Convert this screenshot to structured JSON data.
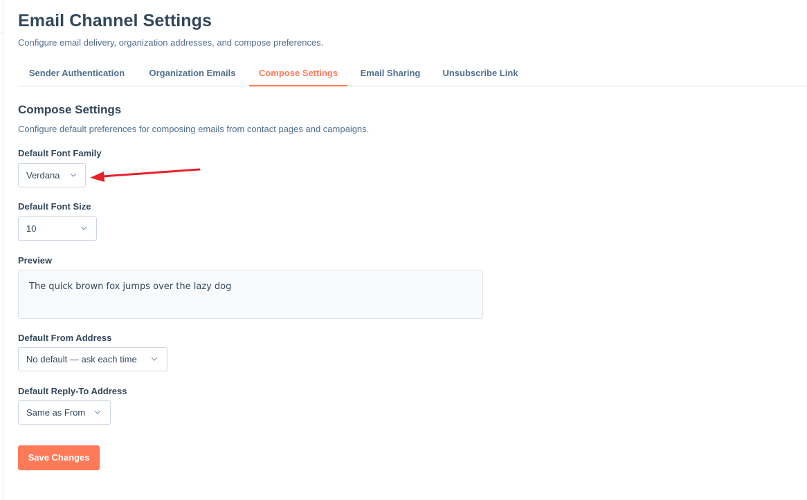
{
  "header": {
    "title": "Email Channel Settings",
    "subtitle": "Configure email delivery, organization addresses, and compose preferences."
  },
  "tabs": [
    {
      "label": "Sender Authentication",
      "active": false
    },
    {
      "label": "Organization Emails",
      "active": false
    },
    {
      "label": "Compose Settings",
      "active": true
    },
    {
      "label": "Email Sharing",
      "active": false
    },
    {
      "label": "Unsubscribe Link",
      "active": false
    }
  ],
  "section": {
    "title": "Compose Settings",
    "description": "Configure default preferences for composing emails from contact pages and campaigns."
  },
  "fields": {
    "font_family": {
      "label": "Default Font Family",
      "value": "Verdana"
    },
    "font_size": {
      "label": "Default Font Size",
      "value": "10"
    },
    "preview": {
      "label": "Preview",
      "text": "The quick brown fox jumps over the lazy dog"
    },
    "from_address": {
      "label": "Default From Address",
      "value": "No default — ask each time"
    },
    "reply_to": {
      "label": "Default Reply-To Address",
      "value": "Same as From"
    }
  },
  "actions": {
    "save_label": "Save Changes"
  },
  "annotation": {
    "type": "arrow",
    "color": "#e8202a",
    "points_to": "font-family-select"
  },
  "icons": {
    "select_chevron": "chevron-down-icon"
  },
  "colors": {
    "accent": "#ff7a59",
    "text_primary": "#33475b",
    "text_secondary": "#516f90",
    "border": "#cbd6e2"
  }
}
